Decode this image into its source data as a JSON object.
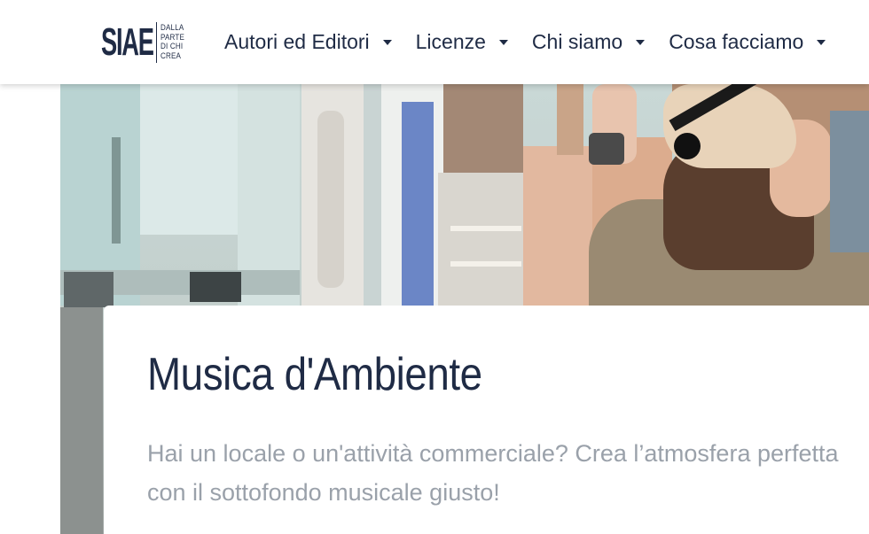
{
  "header": {
    "logo": {
      "mark": "SIAE",
      "tagline": [
        "DALLA",
        "PARTE",
        "DI CHI",
        "CREA"
      ]
    },
    "nav": [
      {
        "label": "Autori ed Editori"
      },
      {
        "label": "Licenze"
      },
      {
        "label": "Chi siamo"
      },
      {
        "label": "Cosa facciamo"
      }
    ]
  },
  "hero": {
    "image": "shopping-woman-hat-photo"
  },
  "card": {
    "title": "Musica d'Ambiente",
    "description": "Hai un locale o un'attività commerciale? Crea l’atmosfera perfetta con il sottofondo musicale giusto!"
  },
  "colors": {
    "brand_navy": "#1f2b45",
    "body_grey": "#9aa1aa",
    "background": "#ffffff"
  }
}
